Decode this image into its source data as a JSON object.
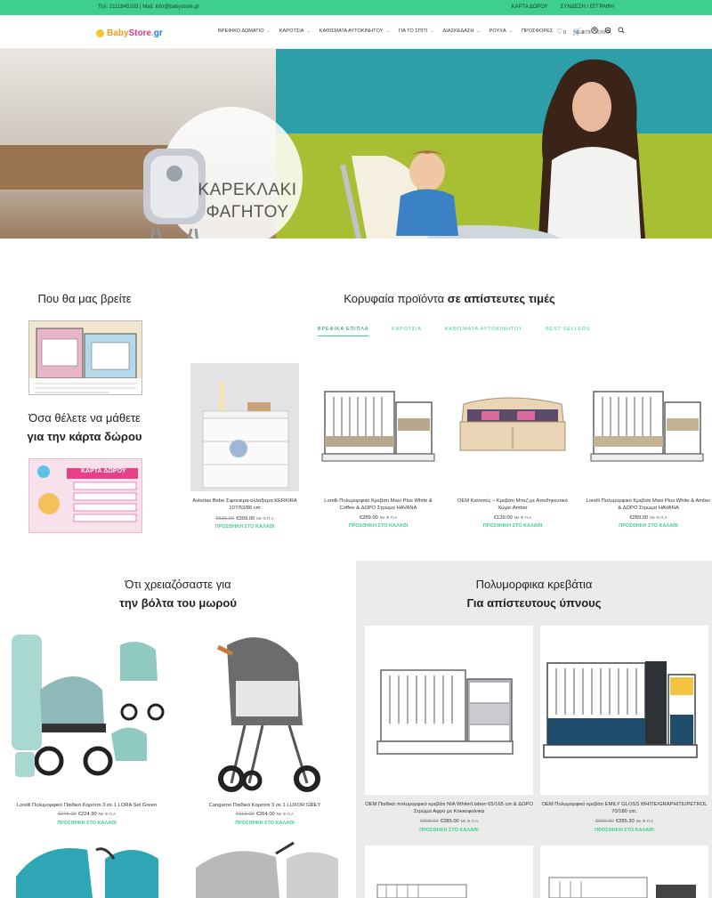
{
  "topbar": {
    "contact": "Τηλ: 2111845103 | Mail: info@babystore.gr",
    "gift_card": "ΚΑΡΤΑ ΔΩΡΟΥ",
    "login": "ΣΥΝΔΕΣΗ / ΕΓΓΡΑΦΗ"
  },
  "header": {
    "logo": {
      "p1": "Baby",
      "p2": "Store",
      "p3": ".",
      "p4": "gr"
    },
    "nav": [
      {
        "label": "ΒΡΕΦΙΚΟ ΔΩΜΑΤΙΟ"
      },
      {
        "label": "ΚΑΡΟΤΣΙΑ"
      },
      {
        "label": "ΚΑΘΙΣΜΑΤΑ ΑΥΤΟΚΙΝΗΤΟΥ"
      },
      {
        "label": "ΓΙΑ ΤΟ ΣΠΙΤΙ"
      },
      {
        "label": "ΔΙΑΣΚΕΔΑΣΗ"
      },
      {
        "label": "ΡΟΥΧΑ"
      },
      {
        "label": "ΠΡΟΣΦΟΡΕΣ"
      }
    ],
    "new_products": "ΝΕΑ ΠΡΟΪΟΝΤΑ",
    "wishlist_count": "0",
    "cart_count": "0"
  },
  "hero": {
    "title_line1": "ΚΑΡΕΚΛΑΚΙ",
    "title_line2": "ΦΑΓΗΤΟΥ"
  },
  "where": {
    "title": "Που θα μας βρείτε"
  },
  "giftcard": {
    "line1": "Όσα θέλετε να μάθετε",
    "line2": "για την κάρτα δώρου",
    "card_title": "ΚΑΡΤΑ ΔΩΡΟΥ"
  },
  "top_products": {
    "title_plain": "Κορυφαία προϊόντα ",
    "title_bold": "σε απίστευτες τιμές",
    "tabs": [
      "ΒΡΕΦΙΚΑ ΕΠΙΠΛΑ",
      "ΚΑΡΟΤΣΙΑ",
      "ΚΑΘΙΣΜΑΤΑ ΑΥΤΟΚΙΝΗΤΟΥ",
      "BEST SELLERS"
    ],
    "items": [
      {
        "name": "Asterias Bebe Σιφονιέρα-αλλαξιέρα KERKIRA 107/53/86 cm",
        "old_price": "€535.00",
        "price": "€399.00",
        "vat": "Με Φ.Π.Α",
        "cart": "ΠΡΟΣΘΗΚΗ ΣΤΟ ΚΑΛΑΘΙ"
      },
      {
        "name": "Lorelli Πολυμορφικό Κρεβάτι Maxi Plus White & Coffee & ΔΩΡΟ Στρώμα HAVANA",
        "old_price": "",
        "price": "€289.00",
        "vat": "Με Φ.Π.Α",
        "cart": "ΠΡΟΣΘΗΚΗ ΣΤΟ ΚΑΛΑΘΙ"
      },
      {
        "name": "OEM Καναπές – Κρεβάτι Μπεζ με Αποθηκευτικό Χώρο Amber",
        "old_price": "",
        "price": "€139.00",
        "vat": "Με Φ.Π.Α",
        "cart": "ΠΡΟΣΘΗΚΗ ΣΤΟ ΚΑΛΑΘΙ"
      },
      {
        "name": "Lorelli Πολυμορφικό Κρεβάτι Maxi Plus White & Amber & ΔΩΡΟ Στρώμα HAVANA",
        "old_price": "",
        "price": "€289.00",
        "vat": "Με Φ.Π.Α",
        "cart": "ΠΡΟΣΘΗΚΗ ΣΤΟ ΚΑΛΑΘΙ"
      }
    ]
  },
  "strollers": {
    "line1": "Ότι χρειαζόσαστε για",
    "line2": "την βόλτα του μωρού",
    "items": [
      {
        "name": "Lorelli Πολυμορφικό Παιδικό Καρότσι 3 σε 1 LORA Set Green",
        "old_price": "€245.00",
        "price": "€224.90",
        "vat": "Με Φ.Π.Α",
        "cart": "ΠΡΟΣΘΗΚΗ ΣΤΟ ΚΑΛΑΘΙ"
      },
      {
        "name": "Cangaroo Παιδικό Καρότσι 3 σε 1 LUXOR GREY",
        "old_price": "€319.00",
        "price": "€264.00",
        "vat": "Με Φ.Π.Α",
        "cart": "ΠΡΟΣΘΗΚΗ ΣΤΟ ΚΑΛΑΘΙ"
      }
    ]
  },
  "beds": {
    "line1": "Πολυμορφικα κρεβάτια",
    "line2": "Για απίστευτους ύπνους",
    "items": [
      {
        "name": "OEM Παιδικό πολυμορφικό κρεβάτι NIA White/Lisbon 65/165 cm & ΔΩΡΟ Στρώμα Αφρο με Κοκκοφοίνικα",
        "old_price": "€300.00",
        "price": "€285.00",
        "vat": "Με Φ.Π.Α",
        "cart": "ΠΡΟΣΘΗΚΗ ΣΤΟ ΚΑΛΑΘΙ"
      },
      {
        "name": "OEM Πολυμορφικό κρεβάτι EMILY GLOSS WHITE/GRAPHITE/PETROL 70/180 cm.",
        "old_price": "€360.00",
        "price": "€285.20",
        "vat": "Με Φ.Π.Α",
        "cart": "ΠΡΟΣΘΗΚΗ ΣΤΟ ΚΑΛΑΘΙ"
      }
    ]
  },
  "colors": {
    "accent": "#3ecf8e",
    "panel_gray": "#ebebeb"
  }
}
